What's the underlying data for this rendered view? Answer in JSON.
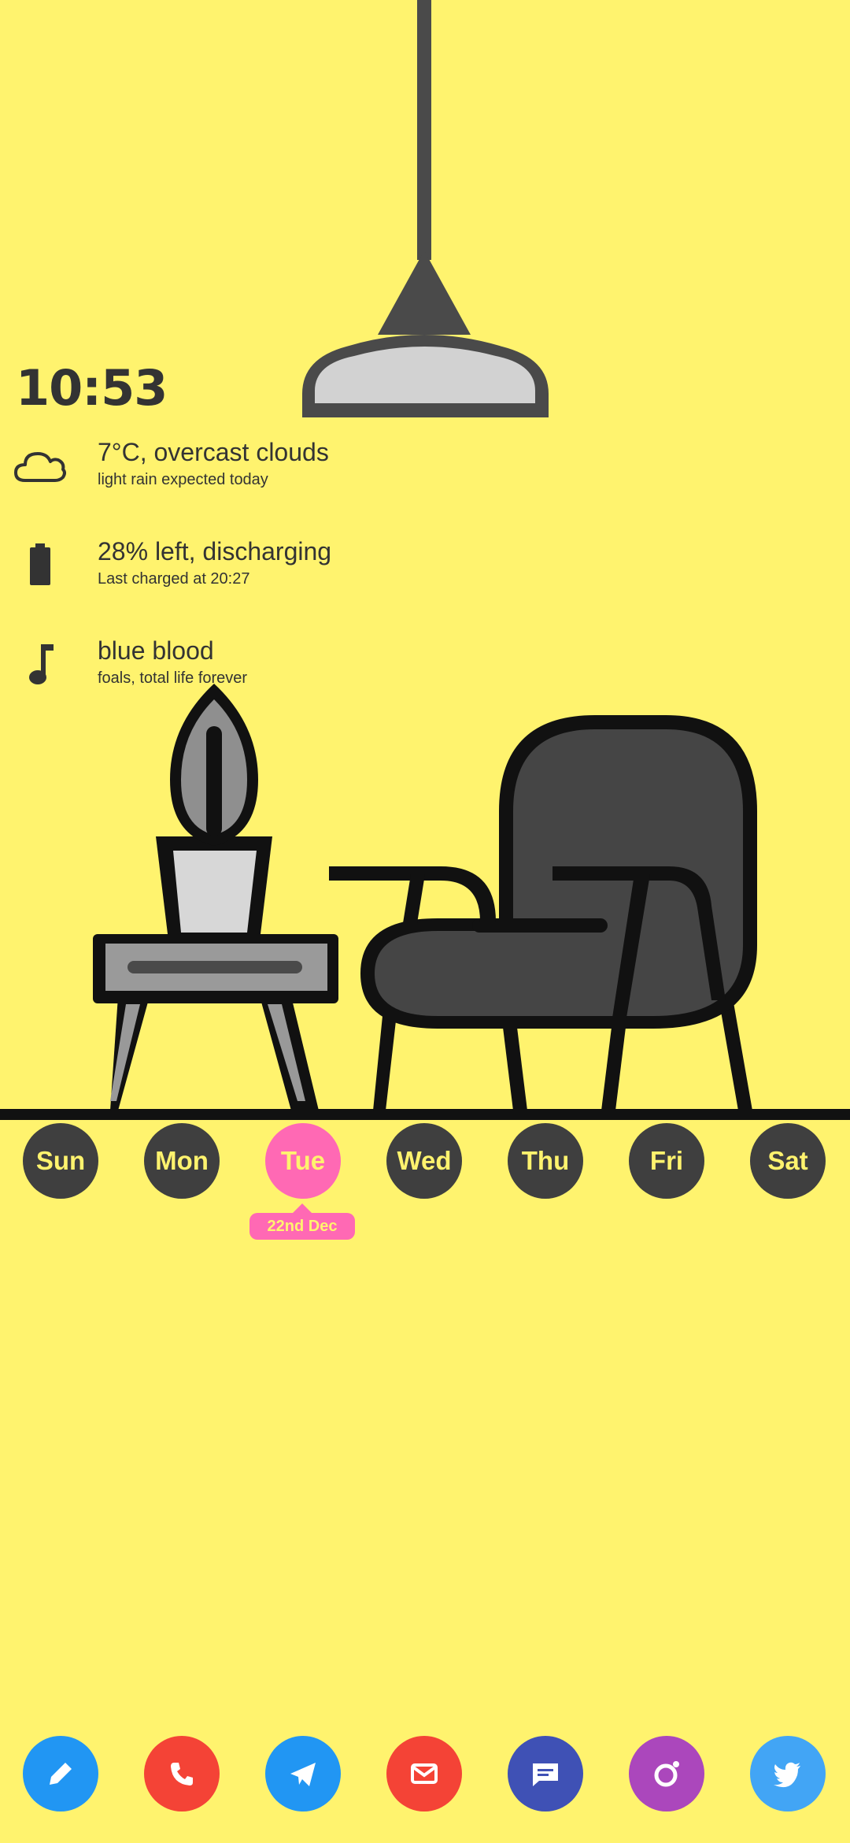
{
  "clock": {
    "time": "10:53"
  },
  "weather": {
    "title": "7°C, overcast clouds",
    "subtitle": "light rain expected today",
    "icon": "cloud-icon"
  },
  "battery": {
    "title": "28% left, discharging",
    "subtitle": "Last charged at 20:27",
    "icon": "battery-icon",
    "level": 0.28
  },
  "music": {
    "title": "blue blood",
    "subtitle": "foals, total life forever",
    "icon": "music-note-icon"
  },
  "calendar": {
    "days": [
      "Sun",
      "Mon",
      "Tue",
      "Wed",
      "Thu",
      "Fri",
      "Sat"
    ],
    "selected_index": 2,
    "selected_date": "22nd Dec"
  },
  "dock": {
    "apps": [
      {
        "name": "notes",
        "icon": "pencil-icon",
        "color": "#2196F3"
      },
      {
        "name": "phone",
        "icon": "phone-icon",
        "color": "#F44336"
      },
      {
        "name": "telegram",
        "icon": "paper-plane-icon",
        "color": "#2196F3"
      },
      {
        "name": "email",
        "icon": "mail-icon",
        "color": "#F44336"
      },
      {
        "name": "messages",
        "icon": "message-icon",
        "color": "#3F51B5"
      },
      {
        "name": "camera",
        "icon": "camera-ring-icon",
        "color": "#AB47BC"
      },
      {
        "name": "twitter",
        "icon": "twitter-bird-icon",
        "color": "#42A5F5"
      }
    ]
  },
  "colors": {
    "background": "#FFF36E",
    "accent": "#FF69B4",
    "dark": "#3f3f3f"
  }
}
